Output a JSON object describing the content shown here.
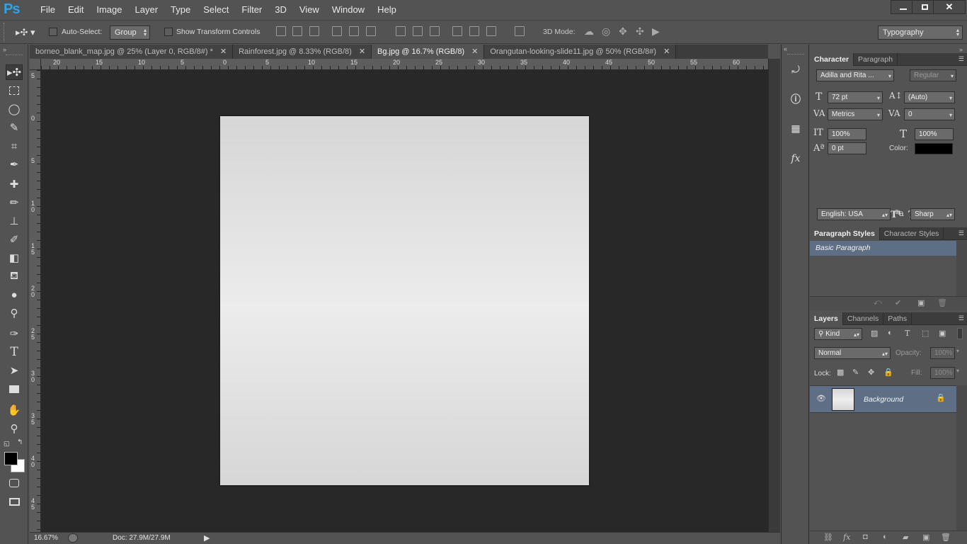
{
  "app": {
    "logo": "Ps"
  },
  "menu": [
    "File",
    "Edit",
    "Image",
    "Layer",
    "Type",
    "Select",
    "Filter",
    "3D",
    "View",
    "Window",
    "Help"
  ],
  "options": {
    "auto_select_label": "Auto-Select:",
    "auto_select_value": "Group",
    "show_transform_label": "Show Transform Controls",
    "mode_3d_label": "3D Mode:",
    "workspace": "Typography"
  },
  "tabs": [
    {
      "label": "borneo_blank_map.jpg @ 25% (Layer 0, RGB/8#) *"
    },
    {
      "label": "Rainforest.jpg @ 8.33% (RGB/8)"
    },
    {
      "label": "Bg.jpg @ 16.7% (RGB/8)"
    },
    {
      "label": "Orangutan-looking-slide11.jpg @ 50% (RGB/8#)"
    }
  ],
  "ruler_h": [
    "20",
    "15",
    "10",
    "5",
    "0",
    "5",
    "10",
    "15",
    "20",
    "25",
    "30",
    "35",
    "40",
    "45",
    "50",
    "55",
    "60"
  ],
  "ruler_v": [
    "5",
    "0",
    "5",
    "1 0",
    "1 5",
    "2 0",
    "2 5",
    "3 0",
    "3 5",
    "4 0",
    "4 5"
  ],
  "status": {
    "zoom": "16.67%",
    "doc": "Doc: 27.9M/27.9M"
  },
  "character": {
    "tab_character": "Character",
    "tab_paragraph": "Paragraph",
    "font_family": "Adilla and Rita ...",
    "font_style": "Regular",
    "font_size": "72 pt",
    "leading": "(Auto)",
    "kerning": "Metrics",
    "tracking": "0",
    "vertical_scale": "100%",
    "horizontal_scale": "100%",
    "baseline_shift": "0 pt",
    "color_label": "Color:",
    "text_color": "#000000",
    "language": "English: USA",
    "antialias": "Sharp"
  },
  "para_styles": {
    "tab_paragraph_styles": "Paragraph Styles",
    "tab_character_styles": "Character Styles",
    "items": [
      "Basic Paragraph"
    ]
  },
  "layers": {
    "tab_layers": "Layers",
    "tab_channels": "Channels",
    "tab_paths": "Paths",
    "filter_kind": "Kind",
    "blend_mode": "Normal",
    "opacity_label": "Opacity:",
    "opacity": "100%",
    "lock_label": "Lock:",
    "fill_label": "Fill:",
    "fill": "100%",
    "items": [
      {
        "name": "Background"
      }
    ]
  }
}
